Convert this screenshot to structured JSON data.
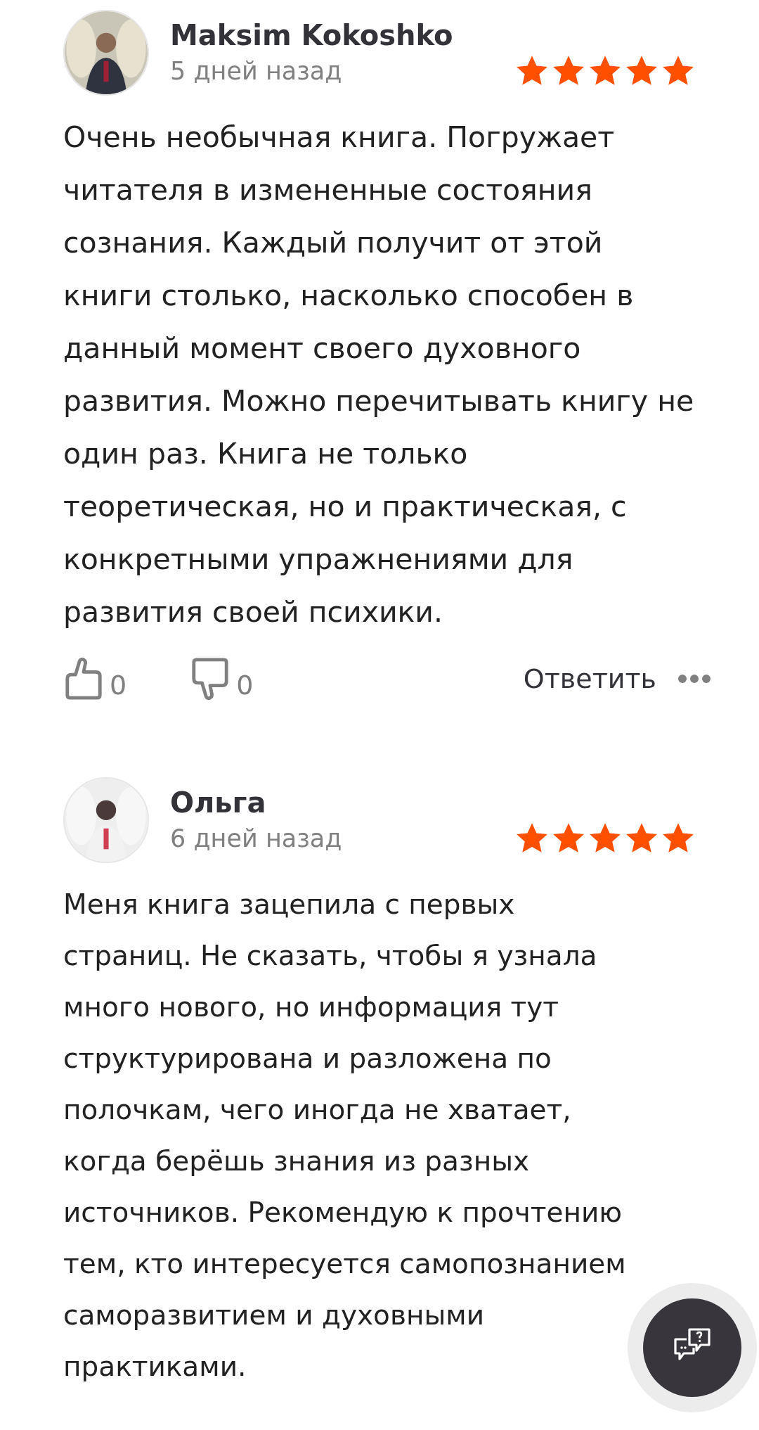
{
  "reviews": [
    {
      "author": "Maksim Kokoshko",
      "date": "5 дней назад",
      "stars": 5,
      "text": "Очень необычная книга. Погружает читателя в измененные состояния сознания. Каждый получит от этой книги столько, насколько способен в данный момент своего духовного развития. Можно перечитывать книгу не один раз. Книга не только теоретическая, но и практическая, с конкретными упражнениями для развития своей психики.",
      "likes": "0",
      "dislikes": "0",
      "reply": "Ответить"
    },
    {
      "author": "Ольга",
      "date": "6 дней назад",
      "stars": 5,
      "text": "Меня книга зацепила с первых страниц. Не сказать, чтобы я узнала много нового, но информация тут структурирована и разложена по полочкам, чего иногда не хватает, когда берёшь знания из разных источников. Рекомендую к прочтению тем, кто интересуется самопознанием саморазвитием и духовными практиками."
    }
  ]
}
